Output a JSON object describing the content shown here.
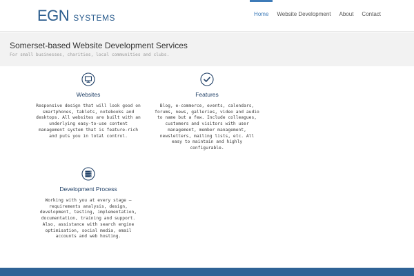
{
  "brand": {
    "name": "EGN",
    "suffix": "SYSTEMS",
    "color": "#2b5d8e"
  },
  "nav": {
    "items": [
      {
        "label": "Home",
        "active": true
      },
      {
        "label": "Website Development",
        "active": false
      },
      {
        "label": "About",
        "active": false
      },
      {
        "label": "Contact",
        "active": false
      }
    ],
    "accent": "#3d7bb8"
  },
  "banner": {
    "title": "Somerset-based Website Development Services",
    "subtitle": "For small businesses, charities, local communities and clubs."
  },
  "features": [
    {
      "icon": "monitor-icon",
      "title": "Websites",
      "text": "Responsive design that will look good on smartphones, tablets, notebooks and desktops. All websites are built with an underlying easy-to-use content management system that is feature-rich and puts you in total control."
    },
    {
      "icon": "check-icon",
      "title": "Features",
      "text": "Blog, e-commerce, events, calendars, forums, news, galleries, video and audio to name but a few. Include colleagues, customers and visitors with user management, member management, newsletters, mailing lists, etc. All easy to maintain and highly configurable."
    },
    {
      "icon": "server-icon",
      "title": "Development Process",
      "text": "Working with you at every stage – requirements analysis, design, development, testing, implementation, documentation, training and support. Also, assistance with search engine optimisation, social media, email accounts and web hosting."
    }
  ],
  "footer": {
    "color": "#2f6396"
  }
}
